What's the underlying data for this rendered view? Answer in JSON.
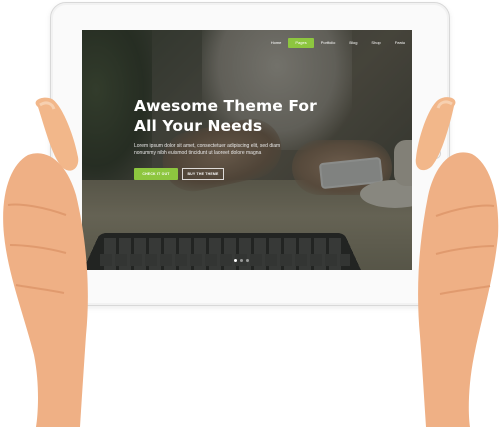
{
  "nav": {
    "items": [
      {
        "label": "Home",
        "active": false
      },
      {
        "label": "Pages",
        "active": true
      },
      {
        "label": "Portfolio",
        "active": false
      },
      {
        "label": "Blog",
        "active": false
      },
      {
        "label": "Shop",
        "active": false
      },
      {
        "label": "Featu",
        "active": false
      }
    ]
  },
  "hero": {
    "title_line1": "Awesome Theme For",
    "title_line2": "All Your Needs",
    "text_line1": "Lorem ipsum dolor sit amet, consectetuer adipiscing elit, sed diam",
    "text_line2": "nonummy nibh euismod tincidunt ut laoreet dolore magna",
    "primary_button": "Check it out",
    "secondary_button": "Buy the theme"
  },
  "slider": {
    "slide_count": 3,
    "active_index": 0
  },
  "colors": {
    "accent": "#8dc63f",
    "tablet_frame": "#fafafa",
    "skin": "#f0b98e"
  },
  "icons": {
    "camera": "camera-icon",
    "home_button": "home-button-icon"
  }
}
